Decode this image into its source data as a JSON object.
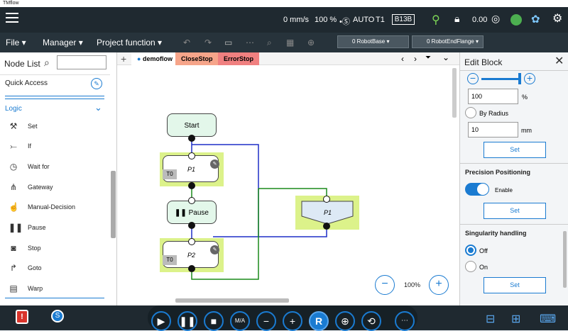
{
  "window": {
    "title": "TMflow"
  },
  "status": {
    "speed": "0 mm/s",
    "percent": "100 %",
    "mode": "AUTO",
    "t1": "T1",
    "badge": "B13B",
    "value": "0.00"
  },
  "menu": {
    "file": "File",
    "manager": "Manager",
    "project_function": "Project function",
    "robot_base": "0 RobotBase",
    "robot_end_flange": "0 RobotEndFlange"
  },
  "left": {
    "title": "Node List",
    "quick_access": "Quick Access",
    "logic": "Logic",
    "items": [
      {
        "label": "Set",
        "icon": "set-icon"
      },
      {
        "label": "If",
        "icon": "if-icon"
      },
      {
        "label": "Wait for",
        "icon": "wait-icon"
      },
      {
        "label": "Gateway",
        "icon": "gateway-icon"
      },
      {
        "label": "Manual-Decision",
        "icon": "manual-decision-icon"
      },
      {
        "label": "Pause",
        "icon": "pause-icon"
      },
      {
        "label": "Stop",
        "icon": "stop-icon"
      },
      {
        "label": "Goto",
        "icon": "goto-icon"
      },
      {
        "label": "Warp",
        "icon": "warp-icon"
      }
    ]
  },
  "tabs": {
    "demoflow": "demoflow",
    "closestop": "CloseStop",
    "errorstop": "ErrorStop"
  },
  "flow": {
    "start": "Start",
    "p1": "P1",
    "t0_a": "T0",
    "pause": "Pause",
    "p2": "P2",
    "t0_b": "T0",
    "p1_side": "P1",
    "zoom": "100%"
  },
  "right": {
    "title": "Edit Block",
    "percent_value": "100",
    "percent_unit": "%",
    "by_radius": "By Radius",
    "radius_value": "10",
    "radius_unit": "mm",
    "set1": "Set",
    "precision": "Precision Positioning",
    "enable": "Enable",
    "set2": "Set",
    "singularity": "Singularity handling",
    "off": "Off",
    "on": "On",
    "set3": "Set"
  },
  "colors": {
    "accent": "#1a7bd1",
    "dark_bar": "#1f2930",
    "tab_closestop": "#f6a58a",
    "tab_errorstop": "#f08080",
    "flow_green": "#dcf28a",
    "blue_line": "#1f2fc7",
    "green_line": "#1a8a1a"
  }
}
